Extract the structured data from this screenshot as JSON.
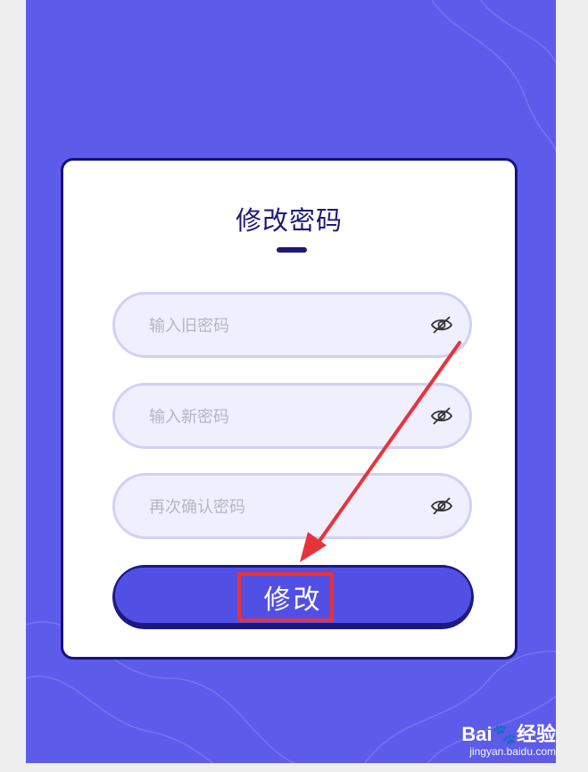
{
  "form": {
    "title": "修改密码",
    "fields": [
      {
        "placeholder": "输入旧密码",
        "icon": "eye-off-icon"
      },
      {
        "placeholder": "输入新密码",
        "icon": "eye-off-icon"
      },
      {
        "placeholder": "再次确认密码",
        "icon": "eye-off-icon"
      }
    ],
    "submit_label": "修改"
  },
  "annotation": {
    "highlight_color": "#e8333a"
  },
  "watermark": {
    "brand": "Bai",
    "brand_suffix": "经验",
    "url": "jingyan.baidu.com"
  },
  "colors": {
    "background": "#5d5bea",
    "card": "#ffffff",
    "accent": "#1c1a78",
    "button": "#5250e4",
    "field_bg": "#f0effd"
  }
}
